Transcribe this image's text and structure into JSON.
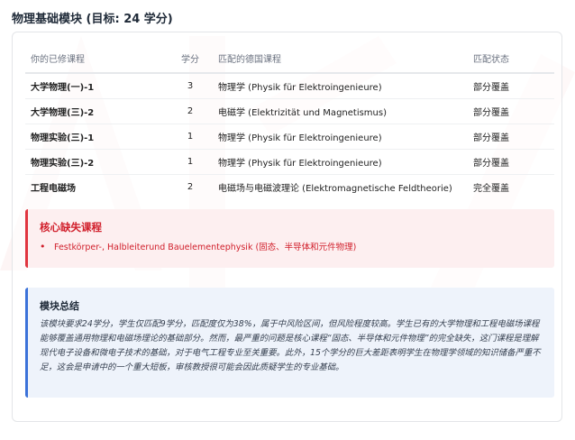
{
  "page": {
    "title": "物理基础模块 (目标: 24 学分)"
  },
  "table": {
    "headers": [
      "你的已修课程",
      "学分",
      "匹配的德国课程",
      "匹配状态"
    ],
    "rows": [
      {
        "course": "大学物理(一)-1",
        "credits": "3",
        "german": "物理学 (Physik für Elektroingenieure)",
        "status": "部分覆盖"
      },
      {
        "course": "大学物理(三)-2",
        "credits": "2",
        "german": "电磁学 (Elektrizität und Magnetismus)",
        "status": "部分覆盖"
      },
      {
        "course": "物理实验(三)-1",
        "credits": "1",
        "german": "物理学 (Physik für Elektroingenieure)",
        "status": "部分覆盖"
      },
      {
        "course": "物理实验(三)-2",
        "credits": "1",
        "german": "物理学 (Physik für Elektroingenieure)",
        "status": "部分覆盖"
      },
      {
        "course": "工程电磁场",
        "credits": "2",
        "german": "电磁场与电磁波理论 (Elektromagnetische Feldtheorie)",
        "status": "完全覆盖"
      }
    ]
  },
  "missing": {
    "title": "核心缺失课程",
    "items": [
      "Festkörper-, Halbleiterund Bauelementephysik (固态、半导体和元件物理)"
    ]
  },
  "summary": {
    "title": "模块总结",
    "text": "该模块要求24学分，学生仅匹配9学分，匹配度仅为38%，属于中风险区间，但风险程度较高。学生已有的大学物理和工程电磁场课程能够覆盖通用物理和电磁场理论的基础部分。然而，最严重的问题是核心课程“固态、半导体和元件物理”的完全缺失，这门课程是理解现代电子设备和微电子技术的基础，对于电气工程专业至关重要。此外，15个学分的巨大差距表明学生在物理学领域的知识储备严重不足，这会是申请中的一个重大短板，审核教授很可能会因此质疑学生的专业基础。"
  },
  "colors": {
    "missing_accent": "#e0353f",
    "summary_accent": "#3b72d9"
  }
}
